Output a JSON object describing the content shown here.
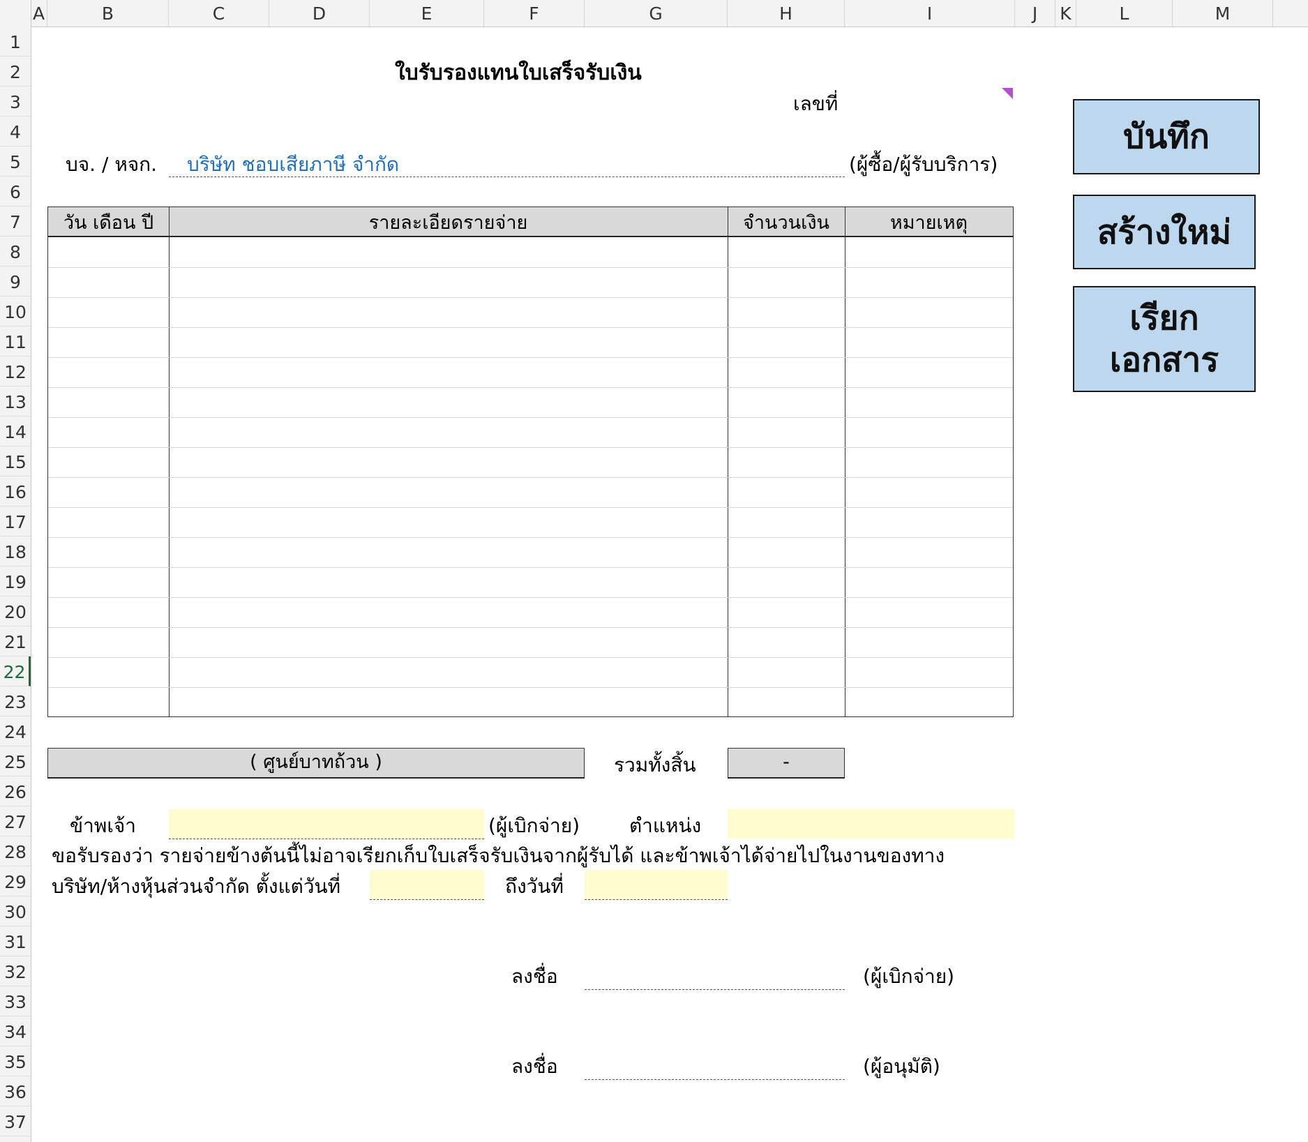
{
  "columns": [
    "A",
    "B",
    "C",
    "D",
    "E",
    "F",
    "G",
    "H",
    "I",
    "J",
    "K",
    "L",
    "M"
  ],
  "rows": [
    "1",
    "2",
    "3",
    "4",
    "5",
    "6",
    "7",
    "8",
    "9",
    "10",
    "11",
    "12",
    "13",
    "14",
    "15",
    "16",
    "17",
    "18",
    "19",
    "20",
    "21",
    "22",
    "23",
    "24",
    "25",
    "26",
    "27",
    "28",
    "29",
    "30",
    "31",
    "32",
    "33",
    "34",
    "35",
    "36",
    "37"
  ],
  "active_row": "22",
  "form": {
    "title": "ใบรับรองแทนใบเสร็จรับเงิน",
    "doc_no_label": "เลขที่",
    "company_label": "บจ. / หจก.",
    "company_value": "บริษัท ชอบเสียภาษี จำกัด",
    "company_suffix": "(ผู้ซื้อ/ผู้รับบริการ)",
    "table_headers": [
      "วัน เดือน ปี",
      "รายละเอียดรายจ่าย",
      "จำนวนเงิน",
      "หมายเหตุ"
    ],
    "amount_in_words": "( ศูนย์บาทถ้วน )",
    "total_label": "รวมทั้งสิ้น",
    "total_value": "-",
    "i_label": "ข้าพเจ้า",
    "i_suffix": "(ผู้เบิกจ่าย)",
    "position_label": "ตำแหน่ง",
    "certify_line1": "ขอรับรองว่า รายจ่ายข้างต้นนี้ไม่อาจเรียกเก็บใบเสร็จรับเงินจากผู้รับได้ และข้าพเจ้าได้จ่ายไปในงานของทาง",
    "certify_line2": "บริษัท/ห้างหุ้นส่วนจำกัด  ตั้งแต่วันที่",
    "to_date_label": "ถึงวันที่",
    "sign_label_1": "ลงชื่อ",
    "sign_role_1": "(ผู้เบิกจ่าย)",
    "sign_label_2": "ลงชื่อ",
    "sign_role_2": "(ผู้อนุมัติ)"
  },
  "buttons": {
    "save": "บันทึก",
    "new": "สร้างใหม่",
    "open_line1": "เรียก",
    "open_line2": "เอกสาร"
  },
  "colors": {
    "button_fill": "#bdd7ee",
    "input_fill": "#fffdd0",
    "header_fill": "#d9d9d9",
    "company_text": "#1f6fbf",
    "active_row": "#1d6a3a",
    "comment_marker": "#b94fd0"
  }
}
